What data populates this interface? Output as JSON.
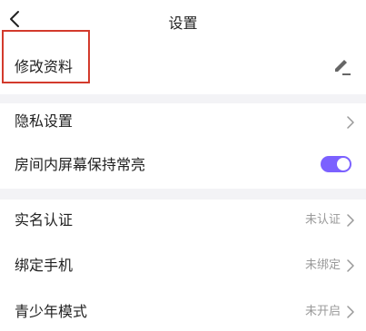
{
  "header": {
    "title": "设置",
    "back_icon": "chevron-left-icon"
  },
  "profile": {
    "label": "修改资料",
    "icon": "pencil-icon"
  },
  "privacy": {
    "label": "隐私设置",
    "icon": "chevron-right-icon"
  },
  "screen_on": {
    "label": "房间内屏幕保持常亮",
    "enabled": true,
    "toggle_color": "#7b61ff"
  },
  "verification": {
    "label": "实名认证",
    "value": "未认证"
  },
  "phone": {
    "label": "绑定手机",
    "value": "未绑定"
  },
  "youth_mode": {
    "label": "青少年模式",
    "value": "未开启"
  },
  "highlight_color": "#d33a2c"
}
